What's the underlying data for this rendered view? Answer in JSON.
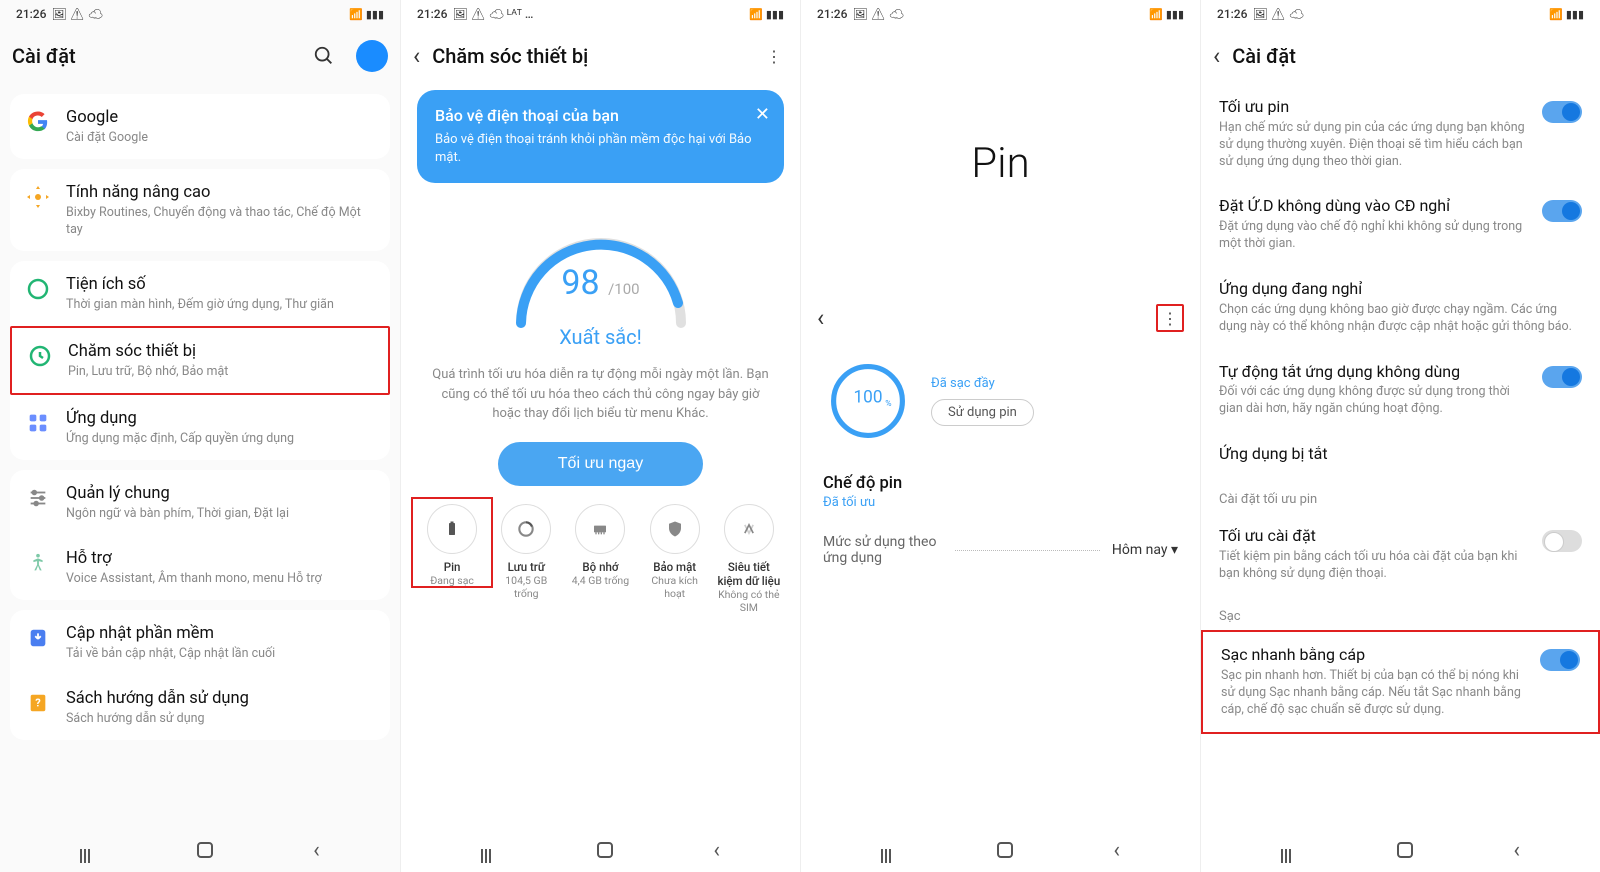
{
  "status": {
    "time": "21:26",
    "left_icons": "🖼 ⚠ ☁",
    "alt_left_icons": "🖼 ⚠ ☁ ᴸᴬᵀ …",
    "right_icons": "📶 ▮▮▮"
  },
  "s1": {
    "title": "Cài đặt",
    "items": [
      {
        "icon": "google-logo",
        "title": "Google",
        "sub": "Cài đặt Google"
      },
      {
        "icon": "advanced-icon",
        "title": "Tính năng nâng cao",
        "sub": "Bixby Routines, Chuyển động và thao tác, Chế độ Một tay"
      },
      {
        "icon": "wellbeing-icon",
        "title": "Tiện ích số",
        "sub": "Thời gian màn hình, Đếm giờ ứng dụng, Thư giãn"
      },
      {
        "icon": "device-care-icon",
        "title": "Chăm sóc thiết bị",
        "sub": "Pin, Lưu trữ, Bộ nhớ, Bảo mật",
        "highlight": true
      },
      {
        "icon": "apps-grid-icon",
        "title": "Ứng dụng",
        "sub": "Ứng dụng mặc định, Cấp quyền ứng dụng"
      },
      {
        "icon": "sliders-icon",
        "title": "Quản lý chung",
        "sub": "Ngôn ngữ và bàn phím, Thời gian, Đặt lại"
      },
      {
        "icon": "accessibility-icon",
        "title": "Hỗ trợ",
        "sub": "Voice Assistant, Âm thanh mono, menu Hỗ trợ"
      },
      {
        "icon": "update-icon",
        "title": "Cập nhật phần mềm",
        "sub": "Tải về bản cập nhật, Cập nhật lần cuối"
      },
      {
        "icon": "manual-icon",
        "title": "Sách hướng dẫn sử dụng",
        "sub": "Sách hướng dẫn sử dụng"
      }
    ]
  },
  "s2": {
    "title": "Chăm sóc thiết bị",
    "banner_title": "Bảo vệ điện thoại của bạn",
    "banner_text": "Bảo vệ điện thoại tránh khỏi phần mềm độc hại với Bảo mật.",
    "score": "98",
    "score_max": "/100",
    "score_label": "Xuất sắc!",
    "desc": "Quá trình tối ưu hóa diễn ra tự động mỗi ngày một lần. Bạn cũng có thể tối ưu hóa theo cách thủ công ngay bây giờ hoặc thay đổi lịch biểu từ menu Khác.",
    "cta": "Tối ưu ngay",
    "tiles": [
      {
        "icon": "battery-icon",
        "title": "Pin",
        "sub": "Đang sạc",
        "highlight": true
      },
      {
        "icon": "storage-icon",
        "title": "Lưu trữ",
        "sub": "104,5 GB trống"
      },
      {
        "icon": "memory-icon",
        "title": "Bộ nhớ",
        "sub": "4,4 GB trống"
      },
      {
        "icon": "shield-icon",
        "title": "Bảo mật",
        "sub": "Chưa kích hoạt"
      },
      {
        "icon": "data-saver-icon",
        "title": "Siêu tiết kiệm dữ liệu",
        "sub": "Không có thẻ SIM"
      }
    ]
  },
  "s3": {
    "big_title": "Pin",
    "percent": "100",
    "unit": "%",
    "charge_status": "Đã sạc đầy",
    "use_batt_btn": "Sử dụng pin",
    "mode_title": "Chế độ pin",
    "mode_sub": "Đã tối ưu",
    "usage_label": "Mức sử dụng theo ứng dụng",
    "dropdown": "Hôm nay"
  },
  "s4": {
    "title": "Cài đặt",
    "items": [
      {
        "title": "Tối ưu pin",
        "sub": "Hạn chế mức sử dụng pin của các ứng dụng bạn không sử dụng thường xuyên. Điện thoại sẽ tìm hiểu cách bạn sử dụng ứng dụng theo thời gian.",
        "toggle": "on"
      },
      {
        "title": "Đặt Ứ.D không dùng vào CĐ nghỉ",
        "sub": "Đặt ứng dụng vào chế độ nghỉ khi không sử dụng trong một thời gian.",
        "toggle": "on"
      },
      {
        "title": "Ứng dụng đang nghỉ",
        "sub": "Chọn các ứng dụng không bao giờ được chạy ngầm. Các ứng dụng này có thể không nhận được cập nhật hoặc gửi thông báo."
      },
      {
        "title": "Tự động tắt ứng dụng không dùng",
        "sub": "Đối với các ứng dụng không được sử dụng trong thời gian dài hơn, hãy ngăn chúng hoạt động.",
        "toggle": "on"
      },
      {
        "title": "Ứng dụng bị tắt"
      }
    ],
    "header1": "Cài đặt tối ưu pin",
    "opt_setting_title": "Tối ưu cài đặt",
    "opt_setting_sub": "Tiết kiệm pin bằng cách tối ưu hóa cài đặt của bạn khi bạn không sử dụng điện thoại.",
    "header2": "Sạc",
    "fast_title": "Sạc nhanh bằng cáp",
    "fast_sub": "Sạc pin nhanh hơn. Thiết bị của bạn có thể bị nóng khi sử dụng Sạc nhanh bằng cáp. Nếu tắt Sạc nhanh bằng cáp, chế độ sạc chuẩn sẽ được sử dụng."
  }
}
